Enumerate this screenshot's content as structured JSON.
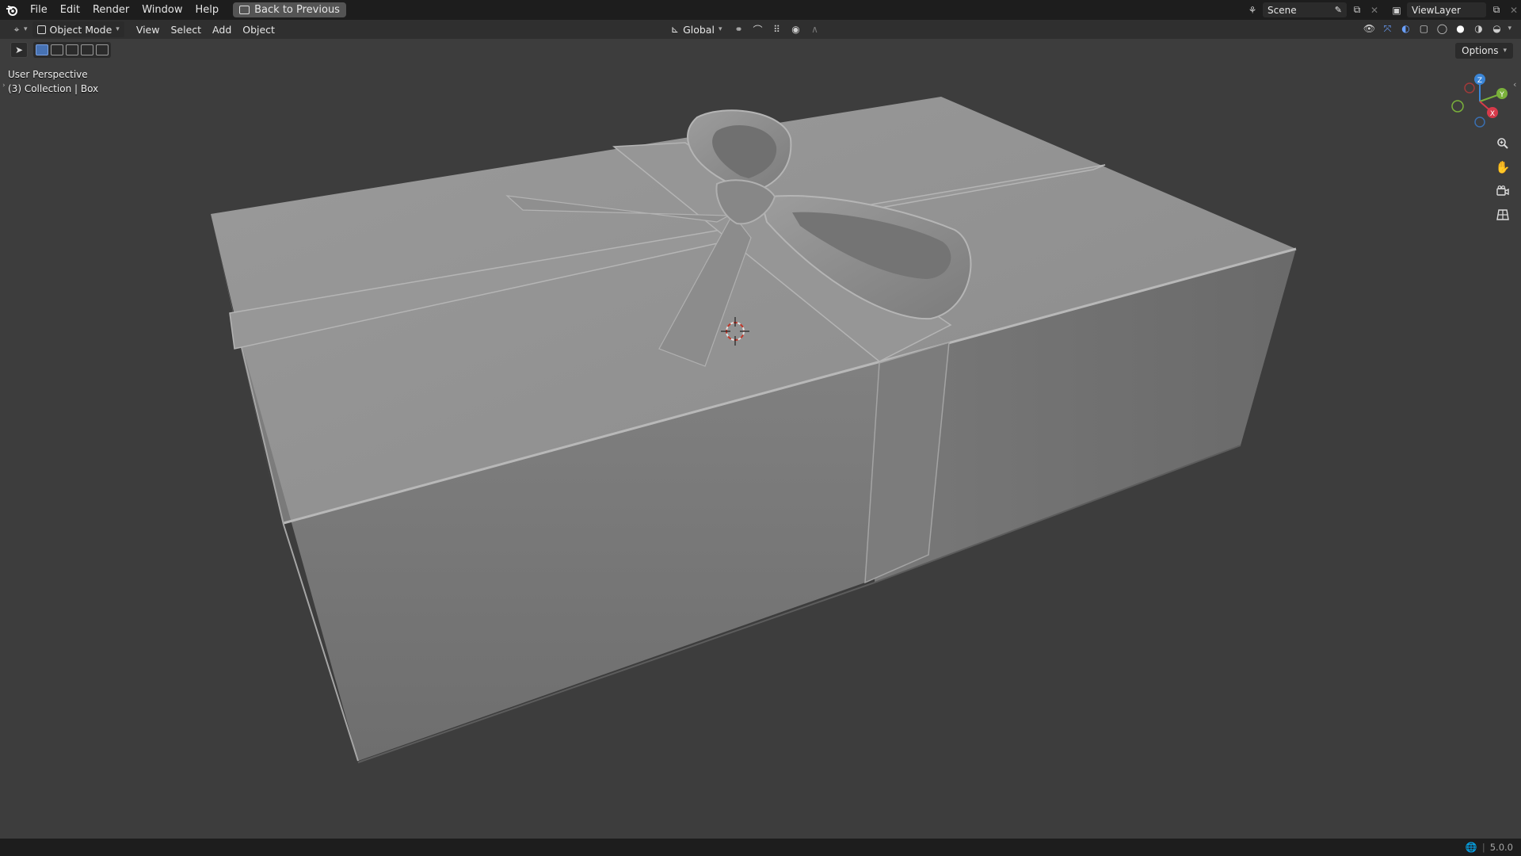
{
  "topbar": {
    "menus": [
      "File",
      "Edit",
      "Render",
      "Window",
      "Help"
    ],
    "back_button": "Back to Previous",
    "scene_name": "Scene",
    "view_layer": "ViewLayer"
  },
  "viewport_header": {
    "mode": "Object Mode",
    "menus": [
      "View",
      "Select",
      "Add",
      "Object"
    ],
    "transform_orientation": "Global"
  },
  "toolrow": {
    "options_label": "Options"
  },
  "overlay": {
    "perspective": "User Perspective",
    "collection": "(3) Collection | Box"
  },
  "gizmo": {
    "axes": [
      "Z",
      "Y",
      "X"
    ],
    "colors": {
      "x": "#d73a4a",
      "y": "#7ab13b",
      "z": "#3a85d7"
    }
  },
  "status": {
    "version": "5.0.0"
  },
  "colors": {
    "background": "#3d3d3d",
    "topbar": "#1d1d1d",
    "header": "#2f2f2f",
    "accent": "#4772b3"
  }
}
